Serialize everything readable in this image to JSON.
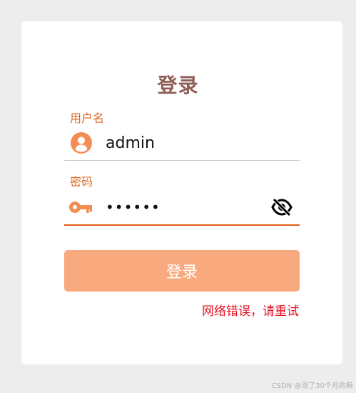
{
  "form": {
    "title": "登录",
    "username_label": "用户名",
    "username_value": "admin",
    "password_label": "密码",
    "password_value": "••••••",
    "submit_label": "登录",
    "error_message": "网络错误，请重试"
  },
  "icons": {
    "user": "user-circle-icon",
    "key": "key-icon",
    "eye": "eye-slash-icon"
  },
  "colors": {
    "accent": "#e2681d",
    "button": "#f9a97e",
    "title": "#8f5d57",
    "error": "#e6101f"
  },
  "watermark": "CSDN @溺了30个月的鲸"
}
